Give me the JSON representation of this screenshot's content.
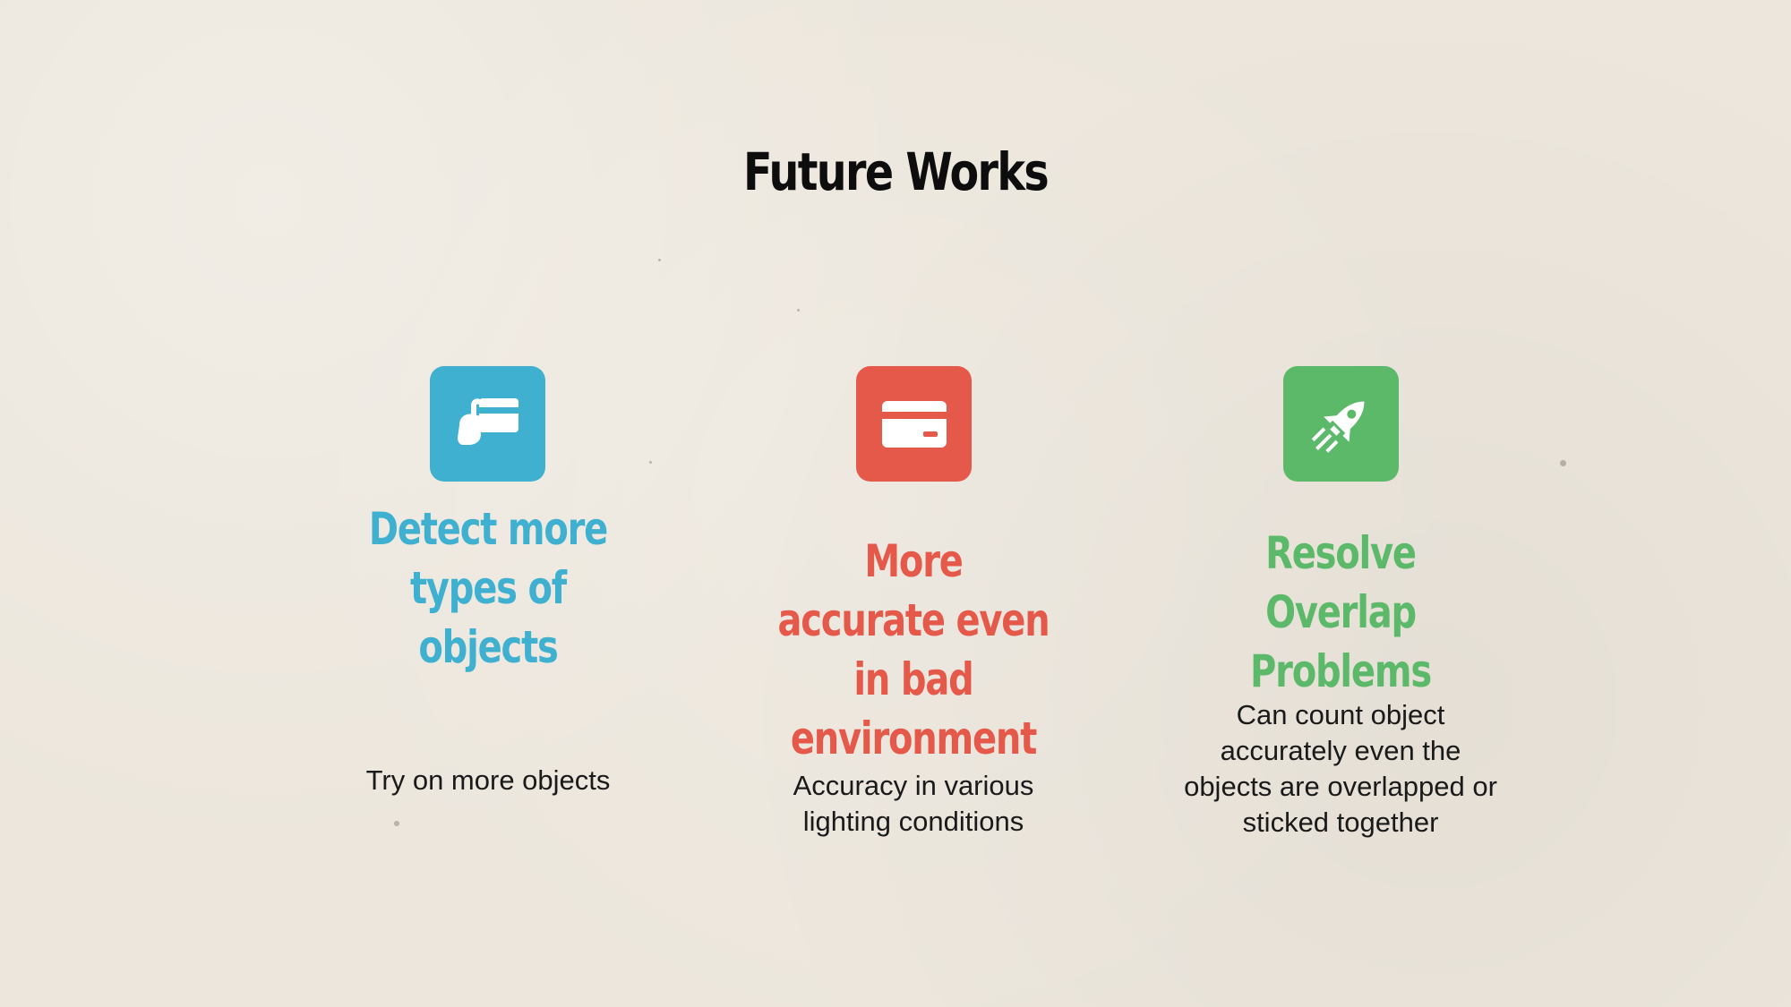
{
  "slide": {
    "title": "Future Works",
    "items": [
      {
        "heading": "Detect more types of objects",
        "description": "Try on more objects",
        "icon": "hand-holding-card-icon",
        "color": "#3fb0d0"
      },
      {
        "heading": "More accurate even in bad environment",
        "description": "Accuracy in various lighting conditions",
        "icon": "credit-card-icon",
        "color": "#e5594a"
      },
      {
        "heading": "Resolve Overlap Problems",
        "description": "Can count object accurately even the objects are overlapped or sticked together",
        "icon": "rocket-icon",
        "color": "#5cb96a"
      }
    ]
  }
}
